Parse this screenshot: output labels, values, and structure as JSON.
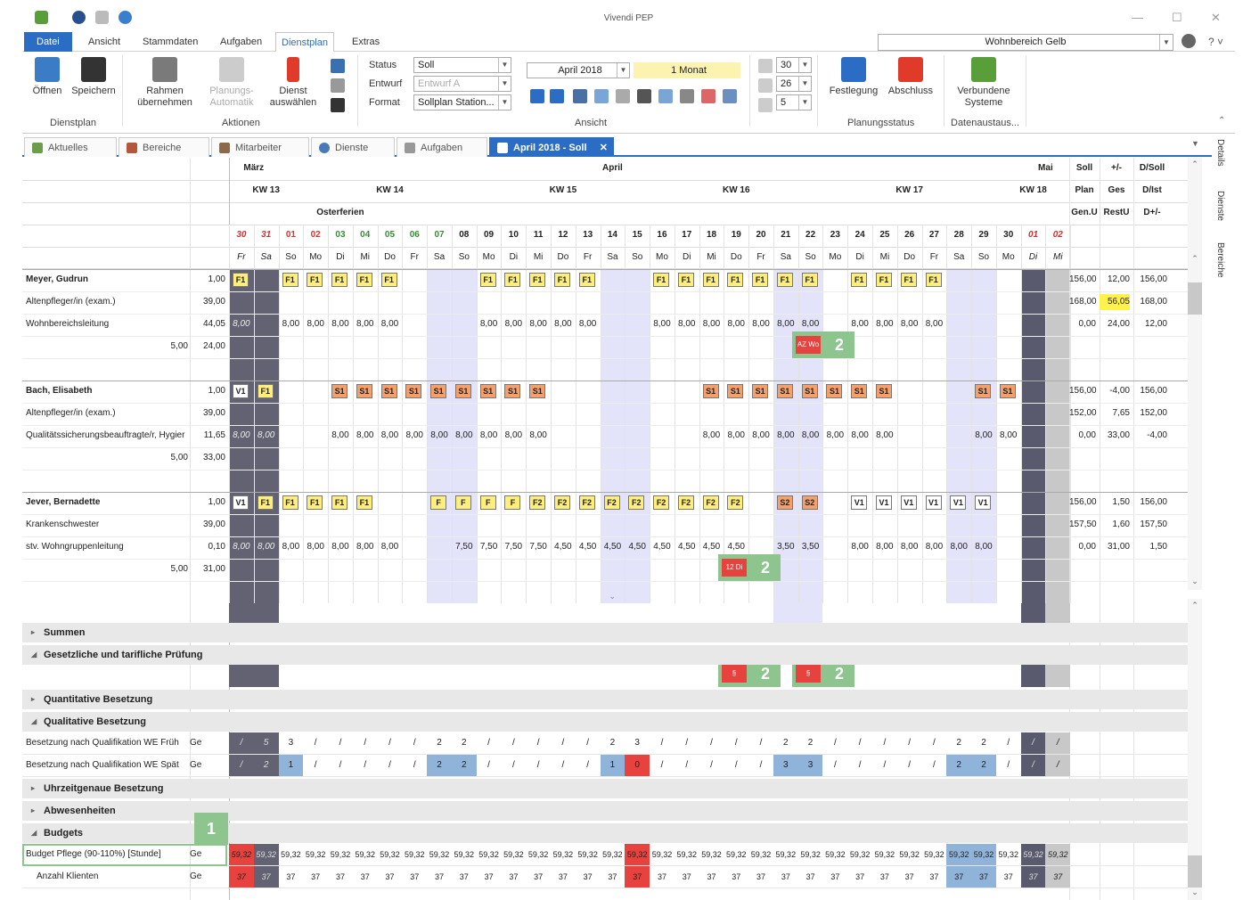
{
  "app": {
    "title": "Vivendi PEP",
    "scope": "Wohnbereich Gelb"
  },
  "tabs": [
    "Datei",
    "Ansicht",
    "Stammdaten",
    "Aufgaben",
    "Dienstplan",
    "Extras"
  ],
  "ribbon": {
    "oeffnen": "Öffnen",
    "speichern": "Speichern",
    "rahmen": "Rahmen übernehmen",
    "planung": "Planungs-Automatik",
    "dienst": "Dienst auswählen",
    "status_lbl": "Status",
    "entwurf_lbl": "Entwurf",
    "format_lbl": "Format",
    "status_val": "Soll",
    "entwurf_val": "Entwurf A",
    "format_val": "Sollplan Station...",
    "month_val": "April 2018",
    "range_val": "1 Monat",
    "n30": "30",
    "n26": "26",
    "n5": "5",
    "festlegung": "Festlegung",
    "abschluss": "Abschluss",
    "verbundene": "Verbundene Systeme",
    "groups": [
      "Dienstplan",
      "Aktionen",
      "Ansicht",
      "Planungsstatus",
      "Datenaustaus..."
    ]
  },
  "doc_tabs": [
    "Aktuelles",
    "Bereiche",
    "Mitarbeiter",
    "Dienste",
    "Aufgaben",
    "April 2018 - Soll"
  ],
  "side_tabs": [
    "Details",
    "Dienste",
    "Bereiche"
  ],
  "header": {
    "months": [
      "März",
      "April",
      "Mai"
    ],
    "kw": [
      "KW 13",
      "KW 14",
      "KW 15",
      "KW 16",
      "KW 17",
      "KW 18"
    ],
    "holiday": "Osterferien",
    "days": [
      "30",
      "31",
      "01",
      "02",
      "03",
      "04",
      "05",
      "06",
      "07",
      "08",
      "09",
      "10",
      "11",
      "12",
      "13",
      "14",
      "15",
      "16",
      "17",
      "18",
      "19",
      "20",
      "21",
      "22",
      "23",
      "24",
      "25",
      "26",
      "27",
      "28",
      "29",
      "30",
      "01",
      "02"
    ],
    "weekdays": [
      "Fr",
      "Sa",
      "So",
      "Mo",
      "Di",
      "Mi",
      "Do",
      "Fr",
      "Sa",
      "So",
      "Mo",
      "Di",
      "Mi",
      "Do",
      "Fr",
      "Sa",
      "So",
      "Mo",
      "Di",
      "Mi",
      "Do",
      "Fr",
      "Sa",
      "So",
      "Mo",
      "Di",
      "Mi",
      "Do",
      "Fr",
      "Sa",
      "So",
      "Mo",
      "Di",
      "Mi"
    ],
    "sum_cols": [
      [
        "Soll",
        "+/-",
        "D/Soll"
      ],
      [
        "Plan",
        "Ges",
        "D/Ist"
      ],
      [
        "Gen.U",
        "RestU",
        "D+/-"
      ]
    ]
  },
  "employees": [
    {
      "name": "Meyer, Gudrun",
      "role": "Altenpfleger/in (exam.)",
      "position": "Wohnbereichsleitung",
      "v1": "1,00",
      "v2": "39,00",
      "v3": "44,05",
      "v4a": "5,00",
      "v4b": "24,00",
      "shifts": {
        "0": "F1",
        "2": "F1",
        "3": "F1",
        "4": "F1",
        "5": "F1",
        "6": "F1",
        "10": "F1",
        "11": "F1",
        "12": "F1",
        "13": "F1",
        "14": "F1",
        "17": "F1",
        "18": "F1",
        "19": "F1",
        "20": "F1",
        "21": "F1",
        "22": "F1",
        "23": "F1",
        "25": "F1",
        "26": "F1",
        "27": "F1",
        "28": "F1"
      },
      "hours": {
        "0": "8,00",
        "2": "8,00",
        "3": "8,00",
        "4": "8,00",
        "5": "8,00",
        "6": "8,00",
        "10": "8,00",
        "11": "8,00",
        "12": "8,00",
        "13": "8,00",
        "14": "8,00",
        "17": "8,00",
        "18": "8,00",
        "19": "8,00",
        "20": "8,00",
        "21": "8,00",
        "22": "8,00",
        "23": "8,00",
        "25": "8,00",
        "26": "8,00",
        "27": "8,00",
        "28": "8,00"
      },
      "sums": [
        [
          "156,00",
          "12,00",
          "156,00"
        ],
        [
          "168,00",
          "56,05",
          "168,00"
        ],
        [
          "0,00",
          "24,00",
          "12,00"
        ]
      ]
    },
    {
      "name": "Bach, Elisabeth",
      "role": "Altenpfleger/in (exam.)",
      "position": "Qualitätssicherungsbeauftragte/r, Hygier",
      "v1": "1,00",
      "v2": "39,00",
      "v3": "11,65",
      "v4a": "5,00",
      "v4b": "33,00",
      "shifts": {
        "0": "V1",
        "1": "F1",
        "4": "S1",
        "5": "S1",
        "6": "S1",
        "7": "S1",
        "8": "S1",
        "9": "S1",
        "10": "S1",
        "11": "S1",
        "12": "S1",
        "19": "S1",
        "20": "S1",
        "21": "S1",
        "22": "S1",
        "23": "S1",
        "24": "S1",
        "25": "S1",
        "26": "S1",
        "30": "S1",
        "31": "S1"
      },
      "hours": {
        "0": "8,00",
        "1": "8,00",
        "4": "8,00",
        "5": "8,00",
        "6": "8,00",
        "7": "8,00",
        "8": "8,00",
        "9": "8,00",
        "10": "8,00",
        "11": "8,00",
        "12": "8,00",
        "19": "8,00",
        "20": "8,00",
        "21": "8,00",
        "22": "8,00",
        "23": "8,00",
        "24": "8,00",
        "25": "8,00",
        "26": "8,00",
        "30": "8,00",
        "31": "8,00"
      },
      "sums": [
        [
          "156,00",
          "-4,00",
          "156,00"
        ],
        [
          "152,00",
          "7,65",
          "152,00"
        ],
        [
          "0,00",
          "33,00",
          "-4,00"
        ]
      ]
    },
    {
      "name": "Jever, Bernadette",
      "role": "Krankenschwester",
      "position": "stv. Wohngruppenleitung",
      "v1": "1,00",
      "v2": "39,00",
      "v3": "0,10",
      "v4a": "5,00",
      "v4b": "31,00",
      "shifts": {
        "0": "V1",
        "1": "F1",
        "2": "F1",
        "3": "F1",
        "4": "F1",
        "5": "F1",
        "8": "F",
        "9": "F",
        "10": "F",
        "11": "F",
        "12": "F2",
        "13": "F2",
        "14": "F2",
        "15": "F2",
        "16": "F2",
        "17": "F2",
        "18": "F2",
        "19": "F2",
        "20": "F2",
        "22": "S2",
        "23": "S2",
        "25": "V1",
        "26": "V1",
        "27": "V1",
        "28": "V1",
        "29": "V1",
        "30": "V1"
      },
      "hours": {
        "0": "8,00",
        "1": "8,00",
        "2": "8,00",
        "3": "8,00",
        "4": "8,00",
        "5": "8,00",
        "6": "8,00",
        "9": "7,50",
        "10": "7,50",
        "11": "7,50",
        "12": "7,50",
        "13": "4,50",
        "14": "4,50",
        "15": "4,50",
        "16": "4,50",
        "17": "4,50",
        "18": "4,50",
        "19": "4,50",
        "20": "4,50",
        "22": "3,50",
        "23": "3,50",
        "25": "8,00",
        "26": "8,00",
        "27": "8,00",
        "28": "8,00",
        "29": "8,00",
        "30": "8,00"
      },
      "sums": [
        [
          "156,00",
          "1,50",
          "156,00"
        ],
        [
          "157,50",
          "1,60",
          "157,50"
        ],
        [
          "0,00",
          "31,00",
          "1,50"
        ]
      ]
    }
  ],
  "markers": {
    "m1": "1",
    "m2": "2",
    "az": "AZ Wo",
    "dk": "12 Di",
    "par": "§"
  },
  "sections": {
    "summen": "Summen",
    "gesetz": "Gesetzliche und tarifliche Prüfung",
    "quant": "Quantitative Besetzung",
    "qual": "Qualitative Besetzung",
    "uhr": "Uhrzeitgenaue Besetzung",
    "abw": "Abwesenheiten",
    "budgets": "Budgets"
  },
  "qual_rows": [
    {
      "label": "Besetzung nach Qualifikation WE Früh",
      "unit": "Ge",
      "vals": [
        "/",
        "5",
        "3",
        "/",
        "/",
        "/",
        "/",
        "/",
        "2",
        "2",
        "/",
        "/",
        "/",
        "/",
        "/",
        "2",
        "3",
        "/",
        "/",
        "/",
        "/",
        "/",
        "2",
        "2",
        "/",
        "/",
        "/",
        "/",
        "/",
        "2",
        "2",
        "/",
        "/",
        "/"
      ]
    },
    {
      "label": "Besetzung nach Qualifikation WE Spät",
      "unit": "Ge",
      "vals": [
        "/",
        "2",
        "1",
        "/",
        "/",
        "/",
        "/",
        "/",
        "2",
        "2",
        "/",
        "/",
        "/",
        "/",
        "/",
        "1",
        "0",
        "/",
        "/",
        "/",
        "/",
        "/",
        "3",
        "3",
        "/",
        "/",
        "/",
        "/",
        "/",
        "2",
        "2",
        "/",
        "/",
        "/"
      ]
    }
  ],
  "budget_rows": [
    {
      "label": "Budget Pflege (90-110%) [Stunde]",
      "unit": "Ge",
      "val": "59,32"
    },
    {
      "label": "Anzahl Klienten",
      "unit": "Ge",
      "val": "37"
    }
  ]
}
